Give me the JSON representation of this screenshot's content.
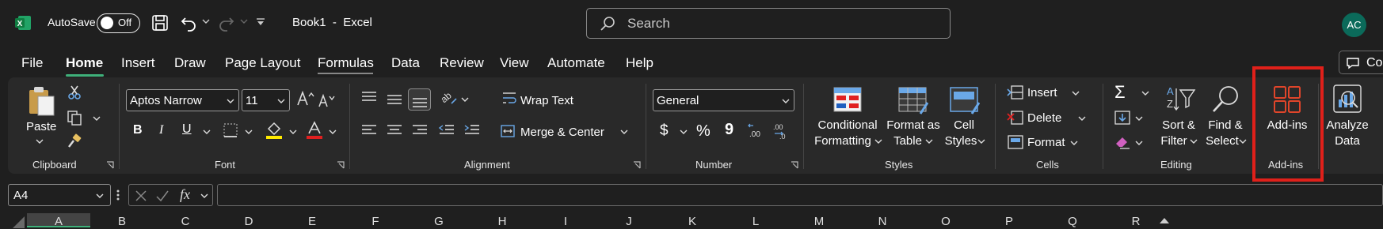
{
  "titlebar": {
    "autosave_label": "AutoSave",
    "autosave_state": "Off",
    "book_title": "Book1  -  Excel",
    "search_placeholder": "Search",
    "avatar_initials": "AC"
  },
  "tabs": [
    "File",
    "Home",
    "Insert",
    "Draw",
    "Page Layout",
    "Formulas",
    "Data",
    "Review",
    "View",
    "Automate",
    "Help"
  ],
  "active_tab": "Home",
  "comments_label": "Com",
  "ribbon": {
    "clipboard": {
      "paste": "Paste",
      "group": "Clipboard"
    },
    "font": {
      "family": "Aptos Narrow",
      "size": "11",
      "group": "Font"
    },
    "alignment": {
      "wrap_text": "Wrap Text",
      "merge_center": "Merge & Center",
      "group": "Alignment"
    },
    "number": {
      "format": "General",
      "currency": "$",
      "percent": "%",
      "comma": "9",
      "group": "Number"
    },
    "styles": {
      "conditional_1": "Conditional",
      "conditional_2": "Formatting",
      "format_table_1": "Format as",
      "format_table_2": "Table",
      "cell_styles_1": "Cell",
      "cell_styles_2": "Styles",
      "group": "Styles"
    },
    "cells": {
      "insert": "Insert",
      "delete": "Delete",
      "format": "Format",
      "group": "Cells"
    },
    "editing": {
      "sort_1": "Sort &",
      "sort_2": "Filter",
      "find_1": "Find &",
      "find_2": "Select",
      "group": "Editing"
    },
    "addins": {
      "button": "Add-ins",
      "group": "Add-ins"
    },
    "analyze": {
      "line1": "Analyze",
      "line2": "Data"
    }
  },
  "formula_bar": {
    "name_box": "A4",
    "fx": "fx",
    "value": ""
  },
  "columns": [
    "A",
    "B",
    "C",
    "D",
    "E",
    "F",
    "G",
    "H",
    "I",
    "J",
    "K",
    "L",
    "M",
    "N",
    "O",
    "P",
    "Q",
    "R"
  ],
  "selected_column": "A",
  "colors": {
    "accent": "#3fb07a",
    "highlight": "#e0201a",
    "addins_icon": "#e0452a",
    "avatar": "#0b6a5a"
  }
}
